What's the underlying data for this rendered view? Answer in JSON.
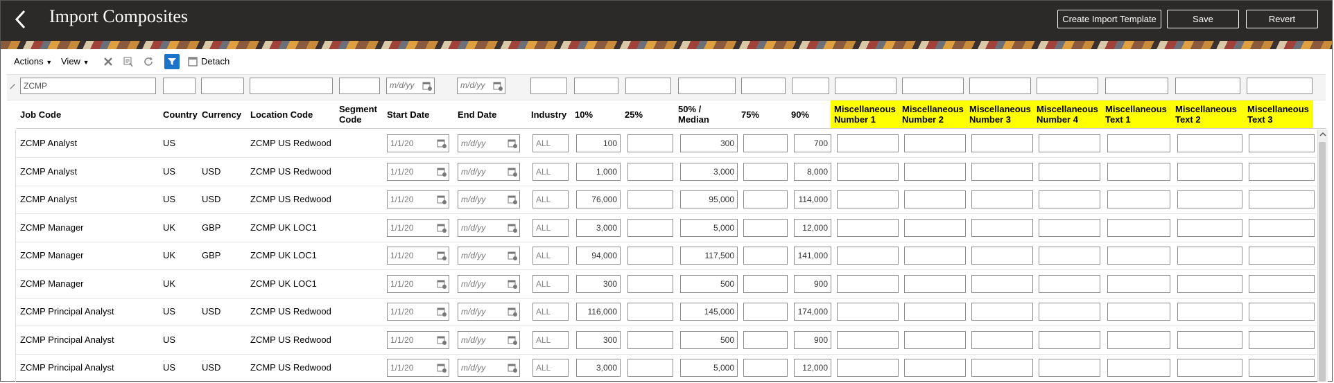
{
  "header": {
    "title": "Import Composites",
    "create_template_label": "Create Import Template",
    "save_label": "Save",
    "revert_label": "Revert"
  },
  "toolbar": {
    "actions_label": "Actions",
    "view_label": "View",
    "detach_label": "Detach"
  },
  "filters": {
    "job_code": "ZCMP",
    "date_placeholder": "m/d/yy"
  },
  "columns": {
    "job_code": "Job Code",
    "country": "Country",
    "currency": "Currency",
    "location_code": "Location Code",
    "segment_code": "Segment Code",
    "start_date": "Start Date",
    "end_date": "End Date",
    "industry": "Industry",
    "p10": "10%",
    "p25": "25%",
    "p50": "50% / Median",
    "p75": "75%",
    "p90": "90%",
    "misc_num1": "Miscellaneous Number 1",
    "misc_num2": "Miscellaneous Number 2",
    "misc_num3": "Miscellaneous Number 3",
    "misc_num4": "Miscellaneous Number 4",
    "misc_text1": "Miscellaneous Text 1",
    "misc_text2": "Miscellaneous Text 2",
    "misc_text3": "Miscellaneous Text 3"
  },
  "rows": [
    {
      "job_code": "ZCMP Analyst",
      "country": "US",
      "currency": "",
      "location": "ZCMP US Redwood",
      "start": "1/1/20",
      "end": "m/d/yy",
      "industry": "ALL",
      "p10": "100",
      "p50": "300",
      "p90": "700"
    },
    {
      "job_code": "ZCMP Analyst",
      "country": "US",
      "currency": "USD",
      "location": "ZCMP US Redwood",
      "start": "1/1/20",
      "end": "m/d/yy",
      "industry": "ALL",
      "p10": "1,000",
      "p50": "3,000",
      "p90": "8,000"
    },
    {
      "job_code": "ZCMP Analyst",
      "country": "US",
      "currency": "USD",
      "location": "ZCMP US Redwood",
      "start": "1/1/20",
      "end": "m/d/yy",
      "industry": "ALL",
      "p10": "76,000",
      "p50": "95,000",
      "p90": "114,000"
    },
    {
      "job_code": "ZCMP Manager",
      "country": "UK",
      "currency": "GBP",
      "location": "ZCMP UK LOC1",
      "start": "1/1/20",
      "end": "m/d/yy",
      "industry": "ALL",
      "p10": "3,000",
      "p50": "5,000",
      "p90": "12,000"
    },
    {
      "job_code": "ZCMP Manager",
      "country": "UK",
      "currency": "GBP",
      "location": "ZCMP UK LOC1",
      "start": "1/1/20",
      "end": "m/d/yy",
      "industry": "ALL",
      "p10": "94,000",
      "p50": "117,500",
      "p90": "141,000"
    },
    {
      "job_code": "ZCMP Manager",
      "country": "UK",
      "currency": "",
      "location": "ZCMP UK LOC1",
      "start": "1/1/20",
      "end": "m/d/yy",
      "industry": "ALL",
      "p10": "300",
      "p50": "500",
      "p90": "900"
    },
    {
      "job_code": "ZCMP Principal Analyst",
      "country": "US",
      "currency": "USD",
      "location": "ZCMP US Redwood",
      "start": "1/1/20",
      "end": "m/d/yy",
      "industry": "ALL",
      "p10": "116,000",
      "p50": "145,000",
      "p90": "174,000"
    },
    {
      "job_code": "ZCMP Principal Analyst",
      "country": "US",
      "currency": "",
      "location": "ZCMP US Redwood",
      "start": "1/1/20",
      "end": "m/d/yy",
      "industry": "ALL",
      "p10": "300",
      "p50": "500",
      "p90": "900"
    },
    {
      "job_code": "ZCMP Principal Analyst",
      "country": "US",
      "currency": "USD",
      "location": "ZCMP US Redwood",
      "start": "1/1/20",
      "end": "m/d/yy",
      "industry": "ALL",
      "p10": "3,000",
      "p50": "5,000",
      "p90": "12,000"
    }
  ],
  "colors": {
    "topbar": "#2c2a29",
    "misc_header_highlight": "#ffff00",
    "detach_icon": "#1a73c8"
  }
}
